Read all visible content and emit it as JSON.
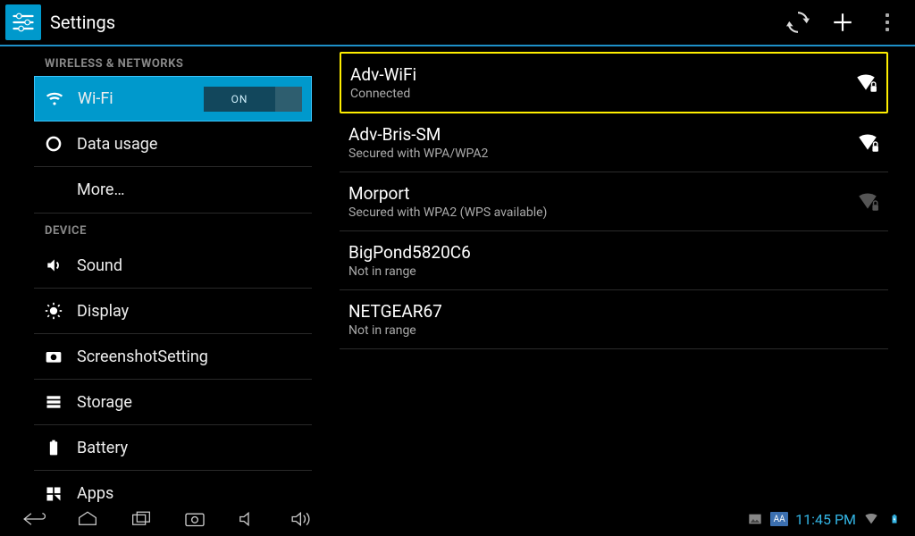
{
  "header": {
    "title": "Settings"
  },
  "sidebar": {
    "section1_label": "WIRELESS & NETWORKS",
    "wifi_label": "Wi-Fi",
    "wifi_toggle": "ON",
    "data_usage_label": "Data usage",
    "more_label": "More…",
    "section2_label": "DEVICE",
    "sound_label": "Sound",
    "display_label": "Display",
    "screenshot_label": "ScreenshotSetting",
    "storage_label": "Storage",
    "battery_label": "Battery",
    "apps_label": "Apps"
  },
  "networks": [
    {
      "ssid": "Adv-WiFi",
      "status": "Connected",
      "signal": "strong",
      "secured": true,
      "highlighted": true
    },
    {
      "ssid": "Adv-Bris-SM",
      "status": "Secured with WPA/WPA2",
      "signal": "strong",
      "secured": true,
      "highlighted": false
    },
    {
      "ssid": "Morport",
      "status": "Secured with WPA2 (WPS available)",
      "signal": "weak",
      "secured": true,
      "highlighted": false
    },
    {
      "ssid": "BigPond5820C6",
      "status": "Not in range",
      "signal": "none",
      "secured": false,
      "highlighted": false
    },
    {
      "ssid": "NETGEAR67",
      "status": "Not in range",
      "signal": "none",
      "secured": false,
      "highlighted": false
    }
  ],
  "statusbar": {
    "clock": "11:45 PM",
    "aa": "AA"
  }
}
